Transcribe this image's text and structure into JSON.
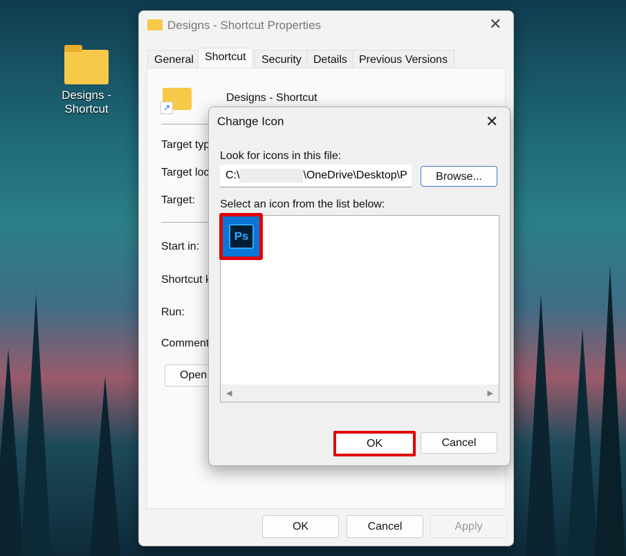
{
  "desktop": {
    "icon_label": "Designs - Shortcut"
  },
  "properties": {
    "title": "Designs - Shortcut Properties",
    "tabs": [
      "General",
      "Shortcut",
      "Security",
      "Details",
      "Previous Versions"
    ],
    "active_tab": "Shortcut",
    "name": "Designs - Shortcut",
    "labels": [
      "Target typ",
      "Target loc",
      "Target:",
      "Start in:",
      "Shortcut k",
      "Run:",
      "Comment"
    ],
    "open_button": "Open",
    "buttons": {
      "ok": "OK",
      "cancel": "Cancel",
      "apply": "Apply"
    }
  },
  "change_icon": {
    "title": "Change Icon",
    "look_label": "Look for icons in this file:",
    "path_prefix": "C:\\",
    "path_suffix": "\\OneDrive\\Desktop\\P",
    "browse": "Browse...",
    "select_label": "Select an icon from the list below:",
    "icon_text": "Ps",
    "ok": "OK",
    "cancel": "Cancel",
    "highlight_color": "#e00000"
  }
}
